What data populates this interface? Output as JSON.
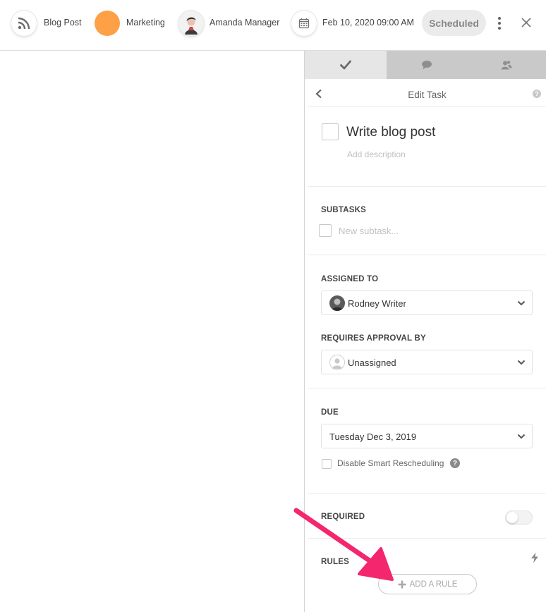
{
  "topbar": {
    "type_label": "Blog Post",
    "campaign_label": "Marketing",
    "owner_label": "Amanda Manager",
    "date_label": "Feb 10, 2020 09:00 AM",
    "status_label": "Scheduled"
  },
  "panel": {
    "header_title": "Edit Task",
    "help_glyph": "?",
    "task": {
      "title": "Write blog post",
      "description_placeholder": "Add description"
    },
    "subtasks": {
      "label": "SUBTASKS",
      "input_placeholder": "New subtask..."
    },
    "assigned": {
      "label": "ASSIGNED TO",
      "value": "Rodney Writer"
    },
    "approval": {
      "label": "REQUIRES APPROVAL BY",
      "value": "Unassigned"
    },
    "due": {
      "label": "DUE",
      "value": "Tuesday Dec 3, 2019",
      "smart_label": "Disable Smart Rescheduling",
      "help_glyph": "?"
    },
    "required": {
      "label": "REQUIRED",
      "enabled": false
    },
    "rules": {
      "label": "RULES",
      "add_label": "ADD A RULE"
    }
  },
  "colors": {
    "accent_orange": "#fda046",
    "arrow_pink": "#f4266e",
    "status_bg": "#ebebeb"
  }
}
